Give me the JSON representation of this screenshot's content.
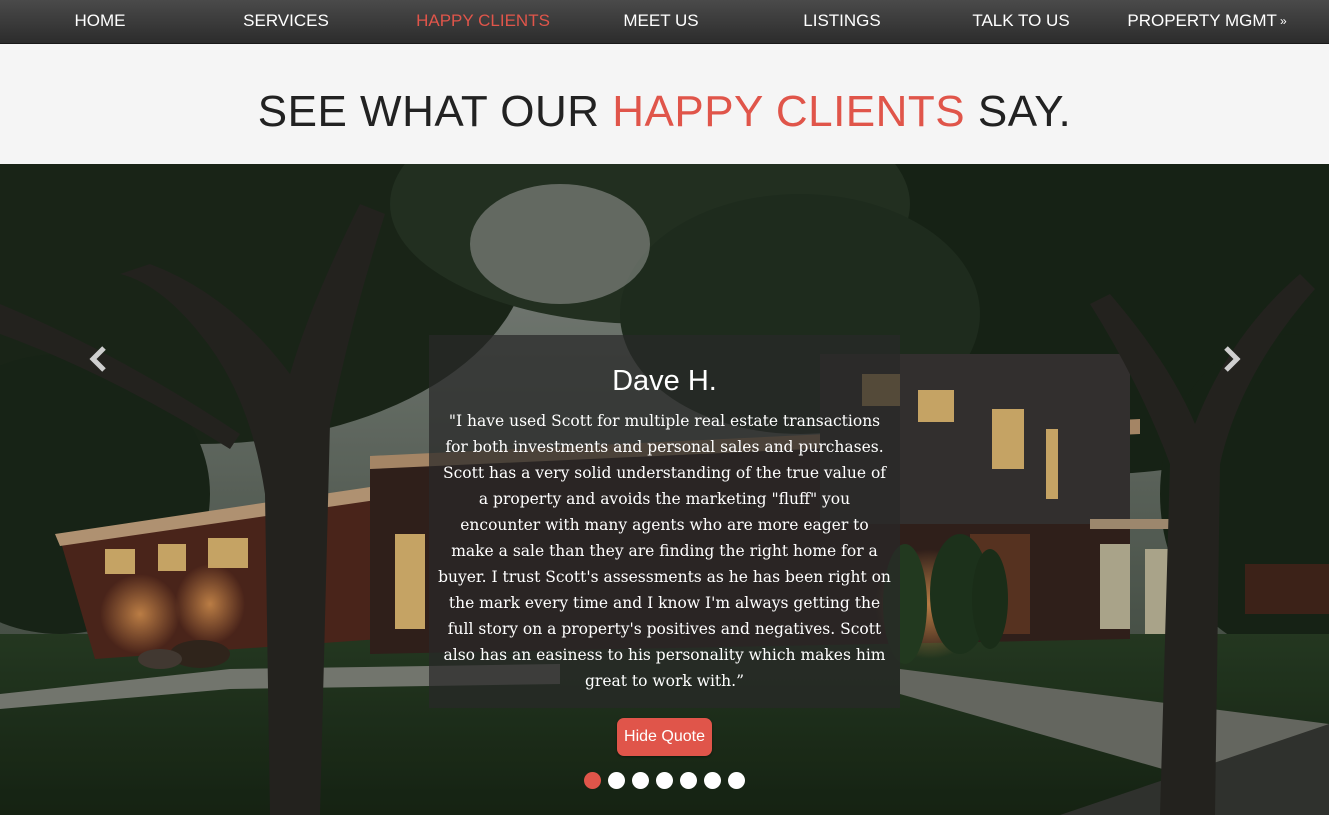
{
  "nav": {
    "items": [
      {
        "label": "HOME"
      },
      {
        "label": "SERVICES"
      },
      {
        "label": "HAPPY CLIENTS",
        "active": true
      },
      {
        "label": "MEET US"
      },
      {
        "label": "LISTINGS"
      },
      {
        "label": "TALK TO US"
      },
      {
        "label": "PROPERTY MGMT",
        "icon": "double-chevron-down-icon"
      }
    ]
  },
  "header": {
    "title_pre": "SEE WHAT OUR ",
    "title_accent": "HAPPY CLIENTS",
    "title_post": " SAY."
  },
  "testimonial": {
    "name": "Dave H.",
    "quote": "\"I have used Scott for multiple real estate transactions for both investments and personal sales and purchases. Scott has a very solid understanding of the true value of a property and avoids the marketing \"fluff\" you encounter with many agents who are more eager to make a sale than they are finding the right home for a buyer. I trust Scott's assessments as he has been right on the mark every time and I know I'm always getting the full story on a property's positives and negatives. Scott also has an easiness to his personality which makes him great to work with.”"
  },
  "controls": {
    "hide_label": "Hide Quote",
    "prev_icon": "chevron-left-icon",
    "next_icon": "chevron-right-icon",
    "slide_count": 7,
    "active_slide": 1
  },
  "colors": {
    "accent": "#e0554a",
    "nav_bg": "#3a3a3a",
    "header_bg": "#f5f5f5"
  }
}
